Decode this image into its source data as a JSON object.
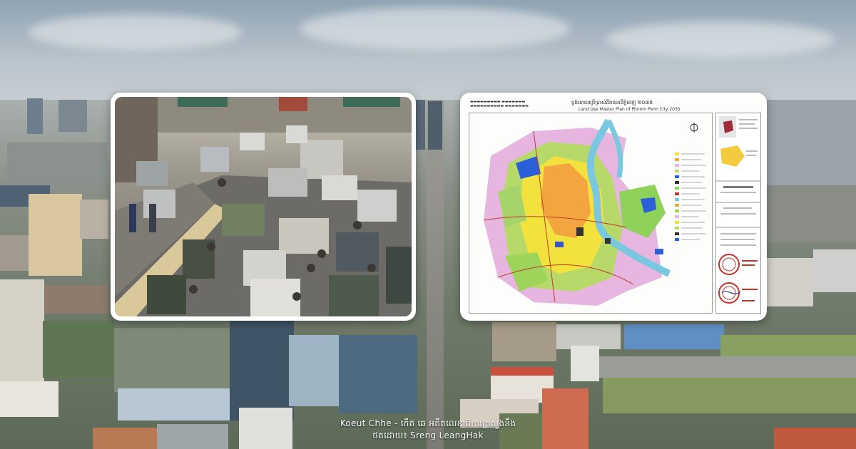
{
  "map": {
    "title_kh": "ប្លង់គោលប្រើប្រាស់ដីរាជធានីភ្នំពេញ ២០៣៥",
    "title_en": "Land Use Master Plan of Phnom Penh City 2035"
  },
  "caption": {
    "line1": "Koeut Chhe - កើត ឆេ អតីតលេខាធិការក្រសួងនឹង",
    "line2": "ថតដោយ៖ Sreng LeangHak"
  }
}
